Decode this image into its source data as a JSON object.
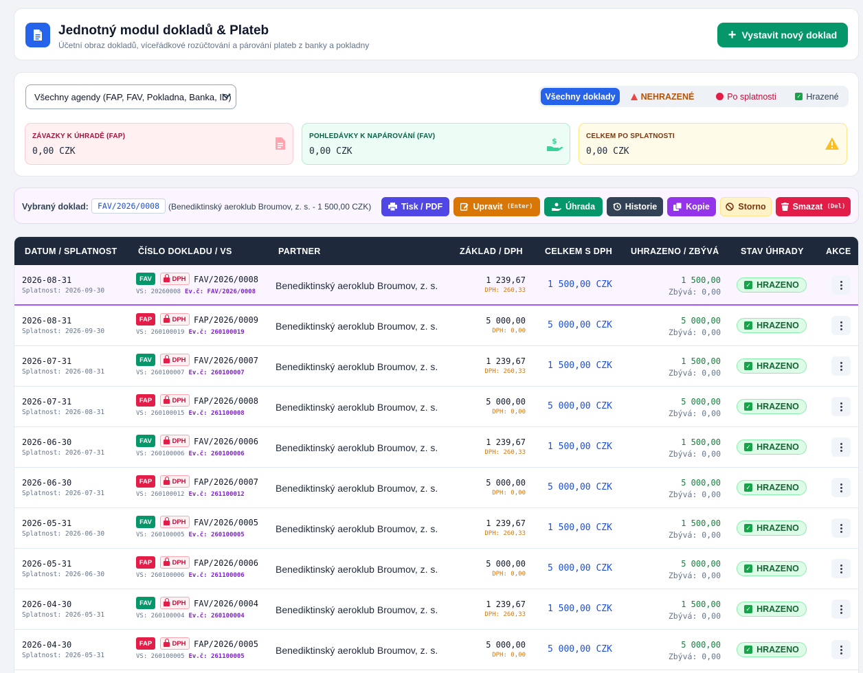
{
  "header": {
    "title": "Jednotný modul dokladů & Plateb",
    "subtitle": "Účetní obraz dokladů, víceřádkové rozúčtování a párování plateb z banky a pokladny",
    "new_doc_button": "Vystavit nový doklad"
  },
  "filters": {
    "agenda": "Všechny agendy (FAP, FAV, Pokladna, Banka, ID)",
    "segments": [
      "Všechny doklady",
      "NEHRAZENÉ",
      "Po splatnosti",
      "Hrazené"
    ],
    "active_segment": "Všechny doklady"
  },
  "stats": [
    {
      "label": "ZÁVAZKY K ÚHRADĚ (FAP)",
      "value": "0,00 CZK",
      "icon": "invoice-icon"
    },
    {
      "label": "POHLEDÁVKY K NAPÁROVÁNÍ (FAV)",
      "value": "0,00 CZK",
      "icon": "hand-money-icon"
    },
    {
      "label": "CELKEM PO SPLATNOSTI",
      "value": "0,00 CZK",
      "icon": "warning-icon"
    }
  ],
  "selection": {
    "label": "Vybraný doklad:",
    "doc": "FAV/2026/0008",
    "desc": "(Benediktinský aeroklub Broumov, z. s. - 1 500,00 CZK)",
    "buttons": {
      "print": "Tisk / PDF",
      "edit": "Upravit",
      "edit_key": "(Enter)",
      "pay": "Úhrada",
      "history": "Historie",
      "copy": "Kopie",
      "storno": "Storno",
      "delete": "Smazat",
      "delete_key": "(Del)"
    }
  },
  "table": {
    "headers": [
      "DATUM / SPLATNOST",
      "ČÍSLO DOKLADU / VS",
      "PARTNER",
      "ZÁKLAD / DPH",
      "CELKEM S DPH",
      "UHRAZENO / ZBÝVÁ",
      "STAV ÚHRADY",
      "AKCE"
    ],
    "dph_tag": "DPH",
    "rows": [
      {
        "date": "2026-08-31",
        "due": "Splatnost: 2026-09-30",
        "type": "FAV",
        "number": "FAV/2026/0008",
        "vs": "VS: 20260008",
        "ev": "Ev.č: FAV/2026/0008",
        "partner": "Benediktinský aeroklub Broumov, z. s.",
        "base": "1 239,67",
        "vat": "DPH: 260,33",
        "total": "1 500,00 CZK",
        "paid": "1 500,00",
        "rem": "Zbývá: 0,00",
        "status": "HRAZENO"
      },
      {
        "date": "2026-08-31",
        "due": "Splatnost: 2026-09-30",
        "type": "FAP",
        "number": "FAP/2026/0009",
        "vs": "VS: 260100019",
        "ev": "Ev.č: 260100019",
        "partner": "Benediktinský aeroklub Broumov, z. s.",
        "base": "5 000,00",
        "vat": "DPH: 0,00",
        "total": "5 000,00 CZK",
        "paid": "5 000,00",
        "rem": "Zbývá: 0,00",
        "status": "HRAZENO"
      },
      {
        "date": "2026-07-31",
        "due": "Splatnost: 2026-08-31",
        "type": "FAV",
        "number": "FAV/2026/0007",
        "vs": "VS: 260100007",
        "ev": "Ev.č: 260100007",
        "partner": "Benediktinský aeroklub Broumov, z. s.",
        "base": "1 239,67",
        "vat": "DPH: 260,33",
        "total": "1 500,00 CZK",
        "paid": "1 500,00",
        "rem": "Zbývá: 0,00",
        "status": "HRAZENO"
      },
      {
        "date": "2026-07-31",
        "due": "Splatnost: 2026-08-31",
        "type": "FAP",
        "number": "FAP/2026/0008",
        "vs": "VS: 260100015",
        "ev": "Ev.č: 261100008",
        "partner": "Benediktinský aeroklub Broumov, z. s.",
        "base": "5 000,00",
        "vat": "DPH: 0,00",
        "total": "5 000,00 CZK",
        "paid": "5 000,00",
        "rem": "Zbývá: 0,00",
        "status": "HRAZENO"
      },
      {
        "date": "2026-06-30",
        "due": "Splatnost: 2026-07-31",
        "type": "FAV",
        "number": "FAV/2026/0006",
        "vs": "VS: 260100006",
        "ev": "Ev.č: 260100006",
        "partner": "Benediktinský aeroklub Broumov, z. s.",
        "base": "1 239,67",
        "vat": "DPH: 260,33",
        "total": "1 500,00 CZK",
        "paid": "1 500,00",
        "rem": "Zbývá: 0,00",
        "status": "HRAZENO"
      },
      {
        "date": "2026-06-30",
        "due": "Splatnost: 2026-07-31",
        "type": "FAP",
        "number": "FAP/2026/0007",
        "vs": "VS: 260100012",
        "ev": "Ev.č: 261100012",
        "partner": "Benediktinský aeroklub Broumov, z. s.",
        "base": "5 000,00",
        "vat": "DPH: 0,00",
        "total": "5 000,00 CZK",
        "paid": "5 000,00",
        "rem": "Zbývá: 0,00",
        "status": "HRAZENO"
      },
      {
        "date": "2026-05-31",
        "due": "Splatnost: 2026-06-30",
        "type": "FAV",
        "number": "FAV/2026/0005",
        "vs": "VS: 260100005",
        "ev": "Ev.č: 260100005",
        "partner": "Benediktinský aeroklub Broumov, z. s.",
        "base": "1 239,67",
        "vat": "DPH: 260,33",
        "total": "1 500,00 CZK",
        "paid": "1 500,00",
        "rem": "Zbývá: 0,00",
        "status": "HRAZENO"
      },
      {
        "date": "2026-05-31",
        "due": "Splatnost: 2026-06-30",
        "type": "FAP",
        "number": "FAP/2026/0006",
        "vs": "VS: 260100006",
        "ev": "Ev.č: 261100006",
        "partner": "Benediktinský aeroklub Broumov, z. s.",
        "base": "5 000,00",
        "vat": "DPH: 0,00",
        "total": "5 000,00 CZK",
        "paid": "5 000,00",
        "rem": "Zbývá: 0,00",
        "status": "HRAZENO"
      },
      {
        "date": "2026-04-30",
        "due": "Splatnost: 2026-05-31",
        "type": "FAV",
        "number": "FAV/2026/0004",
        "vs": "VS: 260100004",
        "ev": "Ev.č: 260100004",
        "partner": "Benediktinský aeroklub Broumov, z. s.",
        "base": "1 239,67",
        "vat": "DPH: 260,33",
        "total": "1 500,00 CZK",
        "paid": "1 500,00",
        "rem": "Zbývá: 0,00",
        "status": "HRAZENO"
      },
      {
        "date": "2026-04-30",
        "due": "Splatnost: 2026-05-31",
        "type": "FAP",
        "number": "FAP/2026/0005",
        "vs": "VS: 260100005",
        "ev": "Ev.č: 261100005",
        "partner": "Benediktinský aeroklub Broumov, z. s.",
        "base": "5 000,00",
        "vat": "DPH: 0,00",
        "total": "5 000,00 CZK",
        "paid": "5 000,00",
        "rem": "Zbývá: 0,00",
        "status": "HRAZENO"
      }
    ]
  }
}
